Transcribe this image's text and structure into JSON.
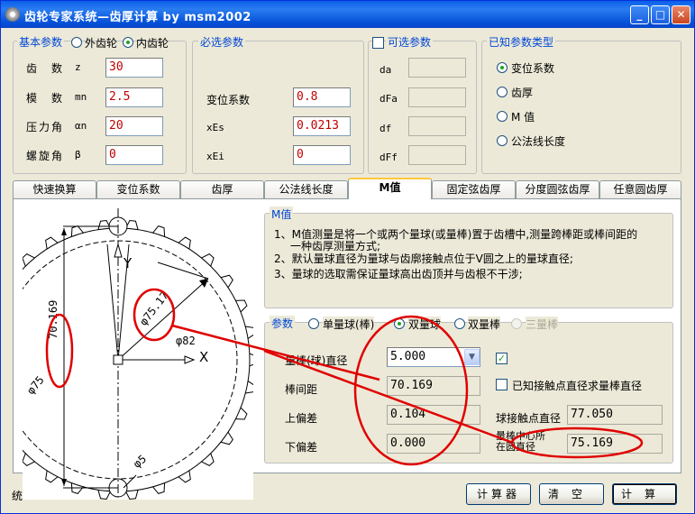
{
  "window": {
    "title": "齿轮专家系统—齿厚计算 by msm2002"
  },
  "basic": {
    "legend": "基本参数",
    "gear_type_external": "外齿轮",
    "gear_type_internal": "内齿轮",
    "teeth_label": "齿　数",
    "teeth_sym": "z",
    "teeth_value": "30",
    "module_label": "模　数",
    "module_sym": "mn",
    "module_value": "2.5",
    "pressure_label": "压力角",
    "pressure_sym": "αn",
    "pressure_value": "20",
    "helix_label": "螺旋角",
    "helix_sym": "β",
    "helix_value": "0"
  },
  "required": {
    "legend": "必选参数",
    "shift_label": "变位系数",
    "shift_value": "0.8",
    "xes_label": "xEs",
    "xes_value": "0.0213",
    "xei_label": "xEi",
    "xei_value": "0"
  },
  "optional": {
    "legend": "可选参数",
    "da": "da",
    "dfa": "dFa",
    "df": "df",
    "dff": "dFf"
  },
  "known": {
    "legend": "已知参数类型",
    "opt1": "变位系数",
    "opt2": "齿厚",
    "opt3": "M 值",
    "opt4": "公法线长度"
  },
  "tabs": [
    "快速换算",
    "变位系数",
    "齿厚",
    "公法线长度",
    "M值",
    "固定弦齿厚",
    "分度圆弦齿厚",
    "任意圆齿厚"
  ],
  "mvalue": {
    "legend": "M值",
    "note1": "1、M值测量是将一个或两个量球(或量棒)置于齿槽中,测量跨棒距或棒间距的",
    "note1b": "一种齿厚测量方式;",
    "note2": "2、默认量球直径为量球与齿廓接触点位于V圆之上的量球直径;",
    "note3": "3、量球的选取需保证量球高出齿顶并与齿根不干涉;"
  },
  "params": {
    "legend": "参数",
    "single": "单量球(棒)",
    "double": "双量球",
    "double_rod": "双量棒",
    "triple": "三量棒",
    "ball_dia_label": "量棒(球)直径",
    "ball_dia_value": "5.000",
    "rod_dist_label": "棒间距",
    "rod_dist_value": "70.169",
    "upper_dev_label": "上偏差",
    "upper_dev_value": "0.104",
    "lower_dev_label": "下偏差",
    "lower_dev_value": "0.000",
    "known_contact": "已知接触点直径求量棒直径",
    "contact_dia_label": "球接触点直径",
    "contact_dia_value": "77.050",
    "center_dia_label1": "量棒中心所",
    "center_dia_label2": "在圆直径",
    "center_dia_value": "75.169"
  },
  "drawing": {
    "dim_70": "70.169",
    "dim_75": "φ75.17",
    "dim_82": "φ82",
    "dim_5": "φ5",
    "dim_75b": "φ75",
    "axis_x": "X",
    "axis_y": "Y"
  },
  "status": {
    "text": "统"
  },
  "buttons": {
    "calculator": "计算器",
    "clear": "清空",
    "compute": "计算"
  }
}
